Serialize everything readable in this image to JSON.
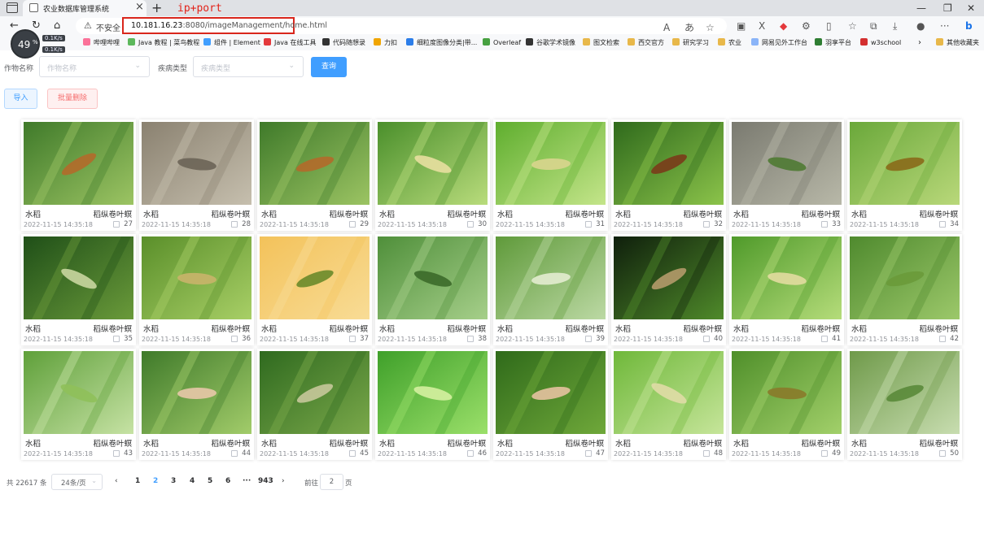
{
  "browser": {
    "tab_title": "农业数据库管理系统",
    "annotation": "ip+port",
    "not_secure": "不安全",
    "url_host": "10.181.16.23",
    "url_rest": ":8080/imageManagement/home.html",
    "speed": {
      "value": "49",
      "unit": "%",
      "up": "0.1K/s",
      "down": "0.1K/s"
    },
    "bookmarks": [
      {
        "label": "哔哩哔哩",
        "color": "#fb7299"
      },
      {
        "label": "Java 教程 | 菜鸟教程",
        "color": "#5cb85c"
      },
      {
        "label": "组件 | Element",
        "color": "#409eff"
      },
      {
        "label": "Java 在线工具",
        "color": "#e4393c"
      },
      {
        "label": "代码随想录",
        "color": "#333333"
      },
      {
        "label": "力扣",
        "color": "#f0a500"
      },
      {
        "label": "细粒度图像分类|带...",
        "color": "#2b7de9"
      },
      {
        "label": "Overleaf",
        "color": "#47a141"
      },
      {
        "label": "谷歌学术镜像",
        "color": "#333333"
      },
      {
        "label": "图文检索",
        "color": "#e8b84a"
      },
      {
        "label": "西交官方",
        "color": "#e8b84a"
      },
      {
        "label": "研究学习",
        "color": "#e8b84a"
      },
      {
        "label": "农业",
        "color": "#e8b84a"
      },
      {
        "label": "网易见外工作台",
        "color": "#8ab4f8"
      },
      {
        "label": "羽享平台",
        "color": "#2e7d32"
      },
      {
        "label": "w3school",
        "color": "#d32f2f"
      },
      {
        "label": "其他收藏夹",
        "color": "#e8b84a"
      }
    ]
  },
  "filters": {
    "crop_label": "作物名称",
    "crop_placeholder": "作物名称",
    "disease_label": "疾病类型",
    "disease_placeholder": "疾病类型",
    "query_button": "查询"
  },
  "actions": {
    "import_button": "导入",
    "batch_delete_button": "批量删除"
  },
  "images": [
    {
      "crop": "水稻",
      "disease": "稻纵卷叶螟",
      "time": "2022-11-15 14:35:18",
      "id": "27",
      "colors": [
        "#3f7a2a",
        "#9cc463"
      ],
      "subject": "#b36a2a"
    },
    {
      "crop": "水稻",
      "disease": "稻纵卷叶螟",
      "time": "2022-11-15 14:35:18",
      "id": "28",
      "colors": [
        "#8a8170",
        "#c6bfae"
      ],
      "subject": "#6b6456"
    },
    {
      "crop": "水稻",
      "disease": "稻纵卷叶螟",
      "time": "2022-11-15 14:35:18",
      "id": "29",
      "colors": [
        "#3f7a2a",
        "#9cc463"
      ],
      "subject": "#b36a2a"
    },
    {
      "crop": "水稻",
      "disease": "稻纵卷叶螟",
      "time": "2022-11-15 14:35:18",
      "id": "30",
      "colors": [
        "#4a8f2b",
        "#b9dc7c"
      ],
      "subject": "#e8dfa0"
    },
    {
      "crop": "水稻",
      "disease": "稻纵卷叶螟",
      "time": "2022-11-15 14:35:18",
      "id": "31",
      "colors": [
        "#5fae2e",
        "#c4e58a"
      ],
      "subject": "#d9d58e"
    },
    {
      "crop": "水稻",
      "disease": "稻纵卷叶螟",
      "time": "2022-11-15 14:35:18",
      "id": "32",
      "colors": [
        "#2f6a1c",
        "#8bc34a"
      ],
      "subject": "#7a3b1a"
    },
    {
      "crop": "水稻",
      "disease": "稻纵卷叶螟",
      "time": "2022-11-15 14:35:18",
      "id": "33",
      "colors": [
        "#7a7a70",
        "#b8b8a8"
      ],
      "subject": "#4f7a33"
    },
    {
      "crop": "水稻",
      "disease": "稻纵卷叶螟",
      "time": "2022-11-15 14:35:18",
      "id": "34",
      "colors": [
        "#6aa83a",
        "#b9d87a"
      ],
      "subject": "#8a6a1a"
    },
    {
      "crop": "水稻",
      "disease": "稻纵卷叶螟",
      "time": "2022-11-15 14:35:18",
      "id": "35",
      "colors": [
        "#1f4f18",
        "#6a9a3a"
      ],
      "subject": "#c9d6a0"
    },
    {
      "crop": "水稻",
      "disease": "稻纵卷叶螟",
      "time": "2022-11-15 14:35:18",
      "id": "36",
      "colors": [
        "#5a8f2a",
        "#a8cf66"
      ],
      "subject": "#c9b46a"
    },
    {
      "crop": "水稻",
      "disease": "稻纵卷叶螟",
      "time": "2022-11-15 14:35:18",
      "id": "37",
      "colors": [
        "#f3c25a",
        "#f8dc96"
      ],
      "subject": "#6a8a2a"
    },
    {
      "crop": "水稻",
      "disease": "稻纵卷叶螟",
      "time": "2022-11-15 14:35:18",
      "id": "38",
      "colors": [
        "#4f8f3a",
        "#a6cf8a"
      ],
      "subject": "#3c6a2a"
    },
    {
      "crop": "水稻",
      "disease": "稻纵卷叶螟",
      "time": "2022-11-15 14:35:18",
      "id": "39",
      "colors": [
        "#5f9a3a",
        "#bcd9a4"
      ],
      "subject": "#e3ecd0"
    },
    {
      "crop": "水稻",
      "disease": "稻纵卷叶螟",
      "time": "2022-11-15 14:35:18",
      "id": "40",
      "colors": [
        "#0f1f0c",
        "#4f8a2a"
      ],
      "subject": "#b49a6a"
    },
    {
      "crop": "水稻",
      "disease": "稻纵卷叶螟",
      "time": "2022-11-15 14:35:18",
      "id": "41",
      "colors": [
        "#4f9a2a",
        "#b5dc7a"
      ],
      "subject": "#e2dca0"
    },
    {
      "crop": "水稻",
      "disease": "稻纵卷叶螟",
      "time": "2022-11-15 14:35:18",
      "id": "42",
      "colors": [
        "#4f8a2e",
        "#9cc86a"
      ],
      "subject": "#6a9a3a"
    },
    {
      "crop": "水稻",
      "disease": "稻纵卷叶螟",
      "time": "2022-11-15 14:35:18",
      "id": "43",
      "colors": [
        "#5fa03a",
        "#c6e2a4"
      ],
      "subject": "#8fc05a"
    },
    {
      "crop": "水稻",
      "disease": "稻纵卷叶螟",
      "time": "2022-11-15 14:35:18",
      "id": "44",
      "colors": [
        "#3f7a2a",
        "#a2cc6a"
      ],
      "subject": "#e8c8a8"
    },
    {
      "crop": "水稻",
      "disease": "稻纵卷叶螟",
      "time": "2022-11-15 14:35:18",
      "id": "45",
      "colors": [
        "#2f6a1f",
        "#7aa84a"
      ],
      "subject": "#c6c89a"
    },
    {
      "crop": "水稻",
      "disease": "稻纵卷叶螟",
      "time": "2022-11-15 14:35:18",
      "id": "46",
      "colors": [
        "#3fa02a",
        "#9be06a"
      ],
      "subject": "#d5f0a0"
    },
    {
      "crop": "水稻",
      "disease": "稻纵卷叶螟",
      "time": "2022-11-15 14:35:18",
      "id": "47",
      "colors": [
        "#2f6a1a",
        "#6fa83a"
      ],
      "subject": "#e6c2a0"
    },
    {
      "crop": "水稻",
      "disease": "稻纵卷叶螟",
      "time": "2022-11-15 14:35:18",
      "id": "48",
      "colors": [
        "#6fb83a",
        "#c6e59a"
      ],
      "subject": "#e0dca6"
    },
    {
      "crop": "水稻",
      "disease": "稻纵卷叶螟",
      "time": "2022-11-15 14:35:18",
      "id": "49",
      "colors": [
        "#4f8f2a",
        "#a2d06a"
      ],
      "subject": "#8a7a2a"
    },
    {
      "crop": "水稻",
      "disease": "稻纵卷叶螟",
      "time": "2022-11-15 14:35:18",
      "id": "50",
      "colors": [
        "#6f9a4a",
        "#c8ddb0"
      ],
      "subject": "#5a8a3a"
    }
  ],
  "pagination": {
    "total": "共 22617 条",
    "page_size": "24条/页",
    "pages": [
      "1",
      "2",
      "3",
      "4",
      "5",
      "6",
      "···",
      "943"
    ],
    "current": "2",
    "goto_label": "前往",
    "goto_value": "2",
    "goto_unit": "页"
  }
}
